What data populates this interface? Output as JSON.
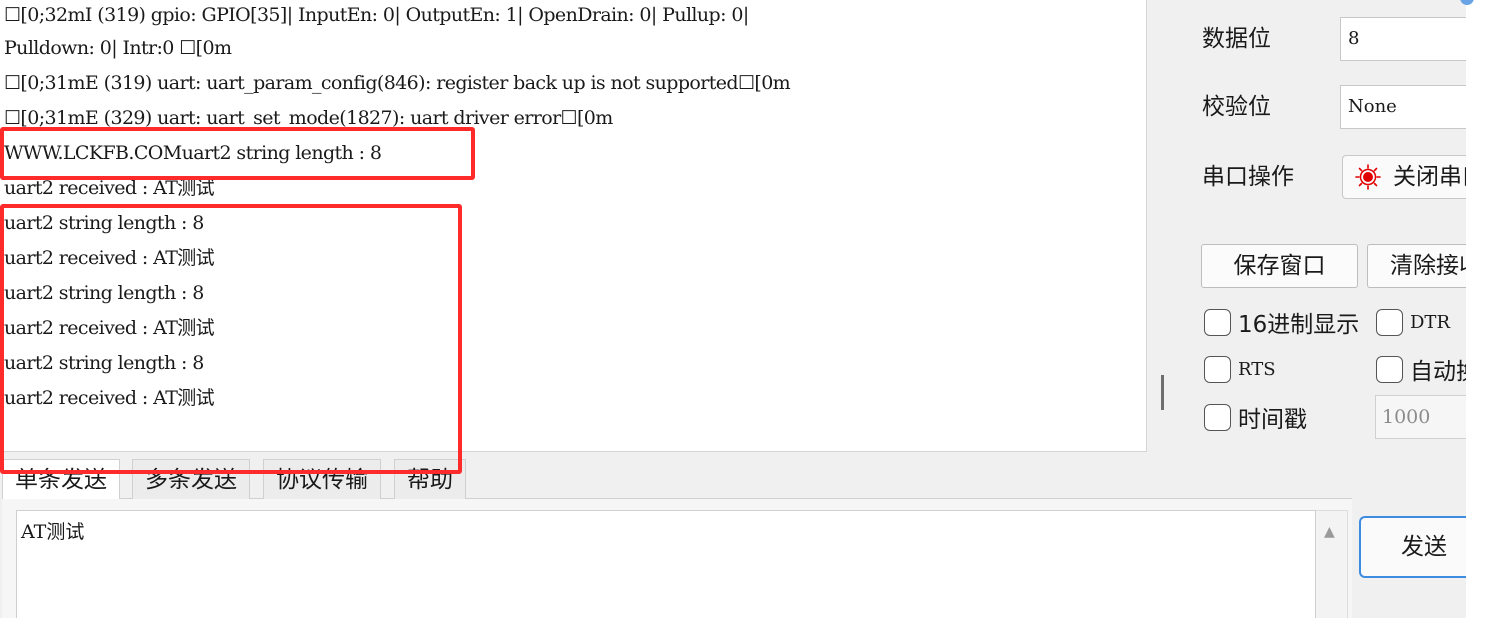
{
  "receive_log": {
    "lines": [
      "☐[0;32mI (319) gpio: GPIO[35]| InputEn: 0| OutputEn: 1| OpenDrain: 0| Pullup: 0|",
      "Pulldown: 0| Intr:0 ☐[0m",
      "☐[0;31mE (319) uart: uart_param_config(846): register back up is not supported☐[0m",
      "☐[0;31mE (329) uart: uart_set_mode(1827): uart driver error☐[0m",
      "WWW.LCKFB.COMuart2 string length : 8",
      "uart2 received : AT测试",
      "uart2 string length : 8",
      "uart2 received : AT测试",
      "uart2 string length : 8",
      "uart2 received : AT测试",
      "uart2 string length : 8",
      "uart2 received : AT测试"
    ]
  },
  "annotation": {
    "color": "#ff2a2a"
  },
  "settings": {
    "data_bits_label": "数据位",
    "data_bits_value": "8",
    "parity_label": "校验位",
    "parity_value": "None",
    "port_op_label": "串口操作",
    "port_toggle_label": "关闭串口",
    "port_toggle_led_color": "#e00000"
  },
  "buttons": {
    "save_window": "保存窗口",
    "clear_receive": "清除接收"
  },
  "options": {
    "hex_display": "16进制显示",
    "dtr": "DTR",
    "rts": "RTS",
    "auto_newline": "自动换行",
    "timestamp": "时间戳",
    "timestamp_interval": "1000"
  },
  "send": {
    "tabs": [
      "单条发送",
      "多条发送",
      "协议传输",
      "帮助"
    ],
    "input_value": "AT测试",
    "send_button": "发送"
  },
  "colors": {
    "accent": "#3d8ce0",
    "window_bg": "#f0f0f0"
  },
  "icons": {
    "scroll_up": "triangle-up-icon",
    "status_led": "red-led-icon"
  }
}
